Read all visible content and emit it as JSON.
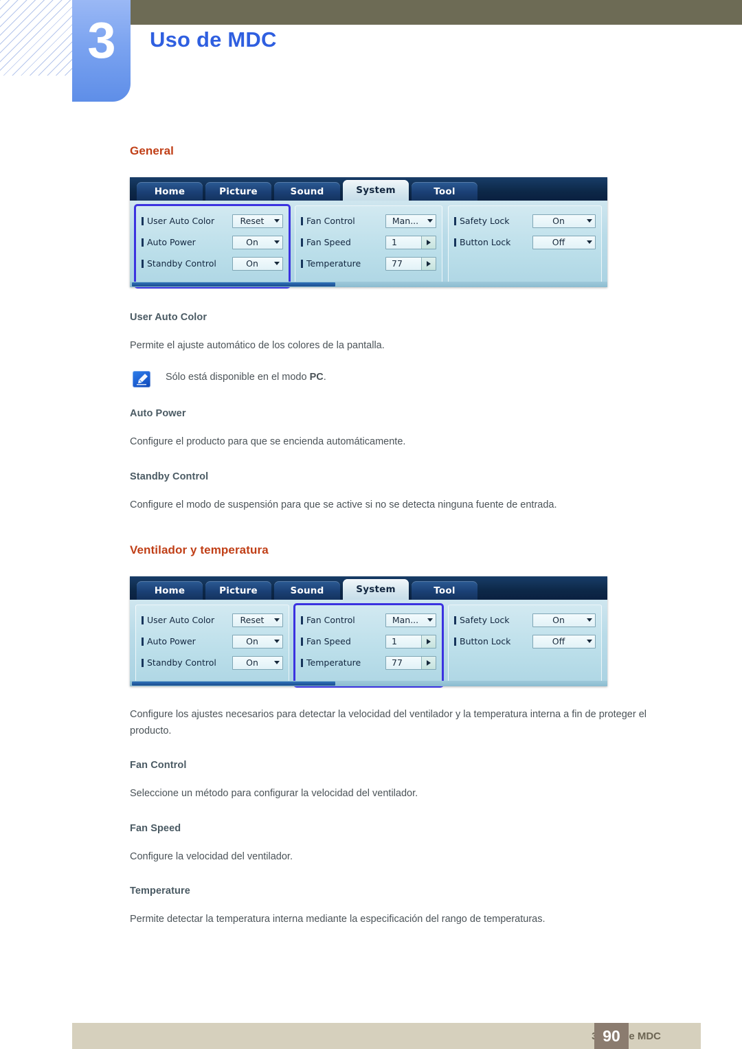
{
  "header": {
    "chapter_number": "3",
    "chapter_title": "Uso de MDC"
  },
  "sections": {
    "general": {
      "heading": "General",
      "sub1": {
        "title": "User Auto Color",
        "body": "Permite el ajuste automático de los colores de la pantalla."
      },
      "note": {
        "icon": "note-pen-icon",
        "text_before": "Sólo está disponible en el modo ",
        "bold": "PC",
        "text_after": "."
      },
      "sub2": {
        "title": "Auto Power",
        "body": "Configure el producto para que se encienda automáticamente."
      },
      "sub3": {
        "title": "Standby Control",
        "body": "Configure el modo de suspensión para que se active si no se detecta ninguna fuente de entrada."
      }
    },
    "fan": {
      "heading": "Ventilador y temperatura",
      "intro": "Configure los ajustes necesarios para detectar la velocidad del ventilador y la temperatura interna a fin de proteger el producto.",
      "sub1": {
        "title": "Fan Control",
        "body": "Seleccione un método para configurar la velocidad del ventilador."
      },
      "sub2": {
        "title": "Fan Speed",
        "body": "Configure la velocidad del ventilador."
      },
      "sub3": {
        "title": "Temperature",
        "body": "Permite detectar la temperatura interna mediante la especificación del rango de temperaturas."
      }
    }
  },
  "mdc": {
    "tabs": [
      {
        "label": "Home",
        "active": false
      },
      {
        "label": "Picture",
        "active": false
      },
      {
        "label": "Sound",
        "active": false
      },
      {
        "label": "System",
        "active": true
      },
      {
        "label": "Tool",
        "active": false
      }
    ],
    "group_general": [
      {
        "label": "User Auto Color",
        "value": "Reset",
        "control": "dropdown"
      },
      {
        "label": "Auto Power",
        "value": "On",
        "control": "dropdown"
      },
      {
        "label": "Standby Control",
        "value": "On",
        "control": "dropdown"
      }
    ],
    "group_fan": [
      {
        "label": "Fan Control",
        "value": "Man...",
        "control": "dropdown"
      },
      {
        "label": "Fan Speed",
        "value": "1",
        "control": "spinner"
      },
      {
        "label": "Temperature",
        "value": "77",
        "control": "spinner"
      }
    ],
    "group_lock": [
      {
        "label": "Safety Lock",
        "value": "On",
        "control": "dropdown"
      },
      {
        "label": "Button Lock",
        "value": "Off",
        "control": "dropdown"
      }
    ],
    "highlight_color": "#3b32e0"
  },
  "footer": {
    "label": "3 Uso de MDC",
    "page_number": "90"
  },
  "colors": {
    "chapter_title": "#2f5fe0",
    "section_heading": "#c03f17",
    "sub_heading": "#4a5a63",
    "body_text": "#4b5358",
    "olive_bar": "#6d6b55",
    "footer_bar": "#d6d0bd",
    "page_box": "#8b7c6f"
  }
}
